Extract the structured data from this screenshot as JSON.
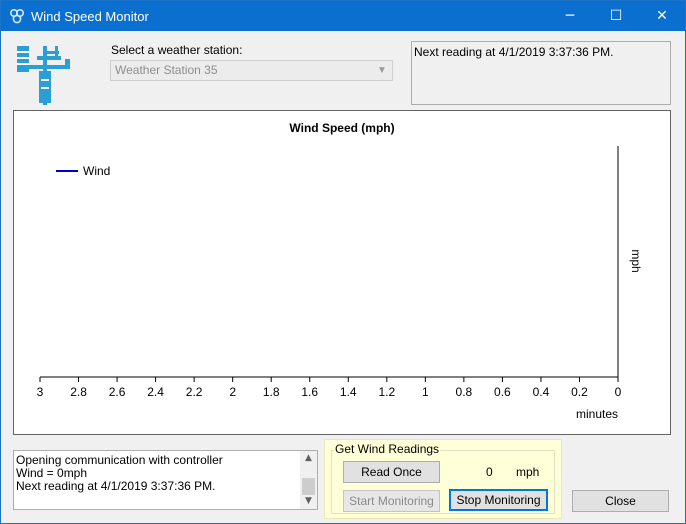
{
  "window": {
    "title": "Wind Speed Monitor",
    "controls": {
      "minimize": "─",
      "maximize": "☐",
      "close": "✕"
    }
  },
  "station": {
    "label": "Select a weather station:",
    "selected": "Weather Station 35",
    "icon": "weather-station-icon"
  },
  "status": {
    "text": "Next reading at 4/1/2019 3:37:36 PM."
  },
  "chart_data": {
    "type": "line",
    "title": "Wind Speed (mph)",
    "xlabel": "minutes",
    "ylabel": "mph",
    "x_ticks": [
      "3",
      "2.8",
      "2.6",
      "2.4",
      "2.2",
      "2",
      "1.8",
      "1.6",
      "1.4",
      "1.2",
      "1",
      "0.8",
      "0.6",
      "0.4",
      "0.2",
      "0"
    ],
    "xlim": [
      3,
      0
    ],
    "series": [
      {
        "name": "Wind",
        "color": "#0000cc",
        "x": [],
        "y": []
      }
    ],
    "legend_position": "top-left",
    "grid": false
  },
  "log": {
    "lines": [
      "Opening communication with controller",
      "Wind = 0mph",
      "Next reading at 4/1/2019 3:37:36 PM."
    ]
  },
  "readings": {
    "group_title": "Get Wind Readings",
    "read_once": "Read Once",
    "start_monitoring": "Start Monitoring",
    "stop_monitoring": "Stop Monitoring",
    "value": "0",
    "unit": "mph"
  },
  "close_button": "Close",
  "colors": {
    "titlebar": "#0b6fcf",
    "group_background": "#ffffd8",
    "series": "#0000cc"
  }
}
